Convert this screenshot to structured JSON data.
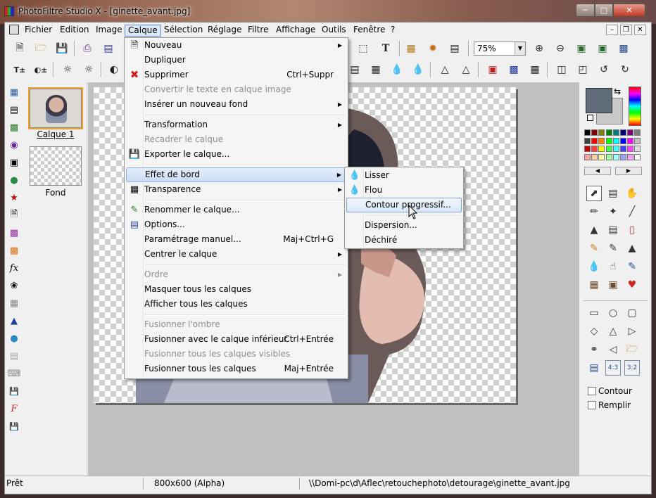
{
  "window": {
    "title": "PhotoFiltre Studio X - [ginette_avant.jpg]"
  },
  "menubar": [
    "Fichier",
    "Edition",
    "Image",
    "Calque",
    "Sélection",
    "Réglage",
    "Filtre",
    "Affichage",
    "Outils",
    "Fenêtre",
    "?"
  ],
  "active_menu": "Calque",
  "toolbar": {
    "zoom_value": "75%"
  },
  "layers": [
    {
      "name": "Calque 1",
      "selected": true
    },
    {
      "name": "Fond",
      "selected": false
    }
  ],
  "calque_menu": {
    "items": [
      {
        "label": "Nouveau",
        "submenu": true,
        "enabled": true,
        "icon": "page-icon"
      },
      {
        "label": "Dupliquer",
        "enabled": true
      },
      {
        "label": "Supprimer",
        "shortcut": "Ctrl+Suppr",
        "enabled": true,
        "icon": "delete-icon"
      },
      {
        "label": "Convertir le texte en calque image",
        "enabled": false
      },
      {
        "label": "Insérer un nouveau fond",
        "submenu": true,
        "enabled": true
      },
      {
        "label": "Transformation",
        "submenu": true,
        "enabled": true
      },
      {
        "label": "Recadrer le calque",
        "enabled": false
      },
      {
        "label": "Exporter le calque...",
        "enabled": true,
        "icon": "save-icon"
      },
      {
        "label": "Effet de bord",
        "submenu": true,
        "enabled": true,
        "highlighted": true
      },
      {
        "label": "Transparence",
        "submenu": true,
        "enabled": true,
        "icon": "transparency-icon"
      },
      {
        "label": "Renommer le calque...",
        "enabled": true,
        "icon": "rename-icon"
      },
      {
        "label": "Options...",
        "enabled": true,
        "icon": "options-icon"
      },
      {
        "label": "Paramétrage manuel...",
        "shortcut": "Maj+Ctrl+G",
        "enabled": true
      },
      {
        "label": "Centrer le calque",
        "submenu": true,
        "enabled": true
      },
      {
        "label": "Ordre",
        "submenu": true,
        "enabled": false
      },
      {
        "label": "Masquer tous les calques",
        "enabled": true
      },
      {
        "label": "Afficher tous les calques",
        "enabled": true
      },
      {
        "label": "Fusionner l'ombre",
        "enabled": false
      },
      {
        "label": "Fusionner avec le calque inférieur",
        "shortcut": "Ctrl+Entrée",
        "enabled": true
      },
      {
        "label": "Fusionner tous les calques visibles",
        "enabled": false
      },
      {
        "label": "Fusionner tous les calques",
        "shortcut": "Maj+Entrée",
        "enabled": true
      }
    ]
  },
  "effet_de_bord_menu": {
    "items": [
      {
        "label": "Lisser",
        "icon": "drop-icon"
      },
      {
        "label": "Flou",
        "icon": "blur-drop-icon"
      },
      {
        "label": "Contour progressif...",
        "highlighted": true
      },
      {
        "label": "Dispersion..."
      },
      {
        "label": "Déchiré"
      }
    ]
  },
  "right_panel": {
    "contour_label": "Contour",
    "remplir_label": "Remplir",
    "contour_checked": false,
    "remplir_checked": false,
    "foreground_color": "#5f6b78",
    "background_color": "#c8c8c8",
    "shape_ratio_43": "4:3",
    "shape_ratio_32": "3:2"
  },
  "statusbar": {
    "state": "Prêt",
    "dimensions": "800x600 (Alpha)",
    "path": "\\\\Domi-pc\\d\\Aflec\\retouchephoto\\detourage\\ginette_avant.jpg"
  }
}
